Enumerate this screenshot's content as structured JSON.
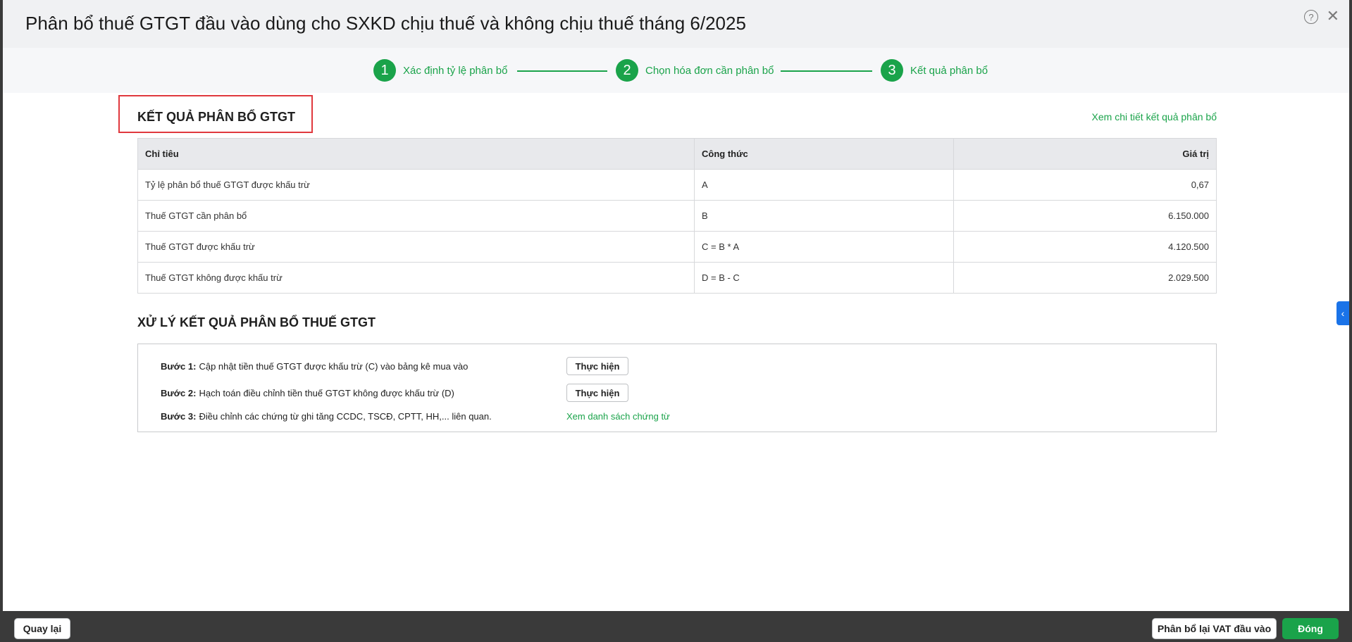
{
  "dialog": {
    "title": "Phân bổ thuế GTGT đầu vào dùng cho SXKD chịu thuế và không chịu thuế tháng 6/2025",
    "help_icon": "?",
    "close_icon": "✕"
  },
  "stepper": {
    "steps": [
      {
        "number": "1",
        "label": "Xác định tỷ lệ phân bổ"
      },
      {
        "number": "2",
        "label": "Chọn hóa đơn cần phân bổ"
      },
      {
        "number": "3",
        "label": "Kết quả phân bổ"
      }
    ],
    "accent_color": "#1aa34a"
  },
  "result": {
    "title": "KẾT QUẢ PHÂN BỔ GTGT",
    "detail_link": "Xem chi tiết kết quả phân bổ",
    "columns": [
      "Chỉ tiêu",
      "Công thức",
      "Giá trị"
    ],
    "rows": [
      {
        "name": "Tỷ lệ phân bổ thuế GTGT được khấu trừ",
        "formula": "A",
        "value": "0,67"
      },
      {
        "name": "Thuế GTGT cần phân bổ",
        "formula": "B",
        "value": "6.150.000"
      },
      {
        "name": "Thuế GTGT được khấu trừ",
        "formula": "C = B * A",
        "value": "4.120.500"
      },
      {
        "name": "Thuế GTGT không được khấu trừ",
        "formula": "D = B - C",
        "value": "2.029.500"
      }
    ]
  },
  "process": {
    "title": "XỬ LÝ KẾT QUẢ PHÂN BỔ THUẾ GTGT",
    "steps": [
      {
        "label": "Bước 1:",
        "text": "Cập nhật tiền thuế GTGT được khấu trừ (C) vào bảng kê mua vào",
        "action": "Thực hiện"
      },
      {
        "label": "Bước 2:",
        "text": "Hạch toán điều chỉnh tiền thuế GTGT không được khấu trừ (D)",
        "action": "Thực hiện"
      },
      {
        "label": "Bước 3:",
        "text": "Điều chỉnh các chứng từ ghi tăng CCDC, TSCĐ, CPTT, HH,... liên quan.",
        "action": "Xem danh sách chứng từ"
      }
    ]
  },
  "side_tab_icon": "‹",
  "footer": {
    "back_label": "Quay lại",
    "reallocate_label": "Phân bổ lại VAT đầu vào",
    "close_label": "Đóng"
  }
}
